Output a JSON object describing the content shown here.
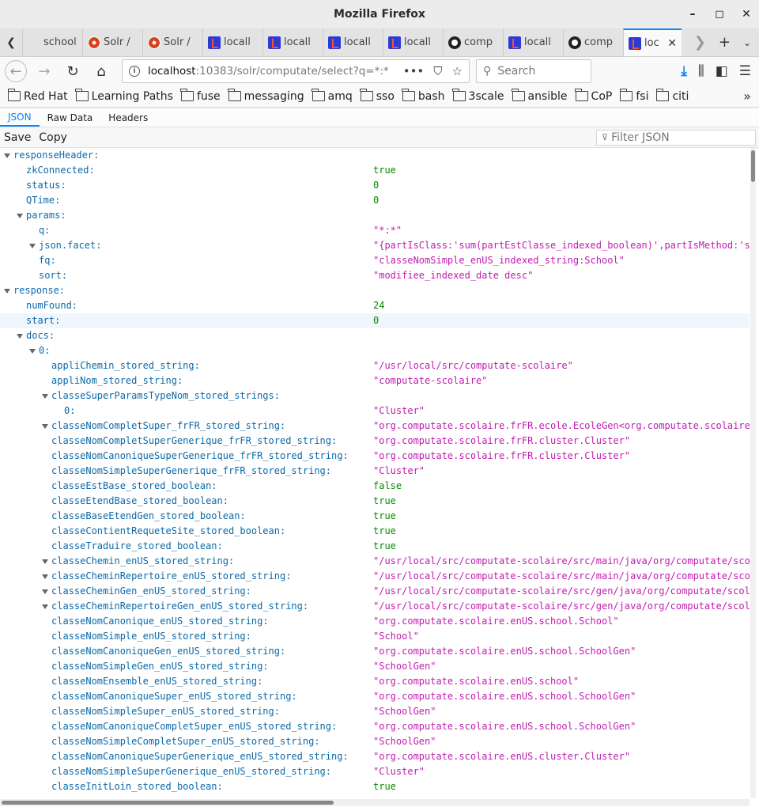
{
  "window": {
    "title": "Mozilla Firefox"
  },
  "tabs": [
    {
      "label": "school.c",
      "icon": "blank-icon"
    },
    {
      "label": "Solr /",
      "icon": "solr-icon"
    },
    {
      "label": "Solr /",
      "icon": "solr-icon"
    },
    {
      "label": "locall",
      "icon": "sonar-icon"
    },
    {
      "label": "locall",
      "icon": "sonar-icon"
    },
    {
      "label": "locall",
      "icon": "sonar-icon"
    },
    {
      "label": "locall",
      "icon": "sonar-icon"
    },
    {
      "label": "comp",
      "icon": "github-icon"
    },
    {
      "label": "locall",
      "icon": "sonar-icon"
    },
    {
      "label": "comp",
      "icon": "github-icon"
    },
    {
      "label": "loc",
      "icon": "sonar-icon",
      "active": true
    }
  ],
  "nav": {
    "url_host": "localhost",
    "url_rest": ":10383/solr/computate/select?q=*:*",
    "search_placeholder": "Search"
  },
  "bookmarks": [
    "Red Hat",
    "Learning Paths",
    "fuse",
    "messaging",
    "amq",
    "sso",
    "bash",
    "3scale",
    "ansible",
    "CoP",
    "fsi",
    "citi"
  ],
  "viewer": {
    "tabs": [
      "JSON",
      "Raw Data",
      "Headers"
    ],
    "save_label": "Save",
    "copy_label": "Copy",
    "filter_placeholder": "Filter JSON"
  },
  "rows": [
    {
      "d": 0,
      "k": "responseHeader:",
      "t": 1
    },
    {
      "d": 1,
      "k": "zkConnected:",
      "v": "true",
      "vt": "bool"
    },
    {
      "d": 1,
      "k": "status:",
      "v": "0",
      "vt": "num"
    },
    {
      "d": 1,
      "k": "QTime:",
      "v": "0",
      "vt": "num"
    },
    {
      "d": 1,
      "k": "params:",
      "t": 1
    },
    {
      "d": 2,
      "k": "q:",
      "v": "\"*:*\"",
      "vt": "str"
    },
    {
      "d": 2,
      "k": "json.facet:",
      "t": 1,
      "v": "\"{partIsClass:'sum(partEstClasse_indexed_boolean)',partIsMethod:'sum",
      "vt": "str"
    },
    {
      "d": 2,
      "k": "fq:",
      "v": "\"classeNomSimple_enUS_indexed_string:School\"",
      "vt": "str"
    },
    {
      "d": 2,
      "k": "sort:",
      "v": "\"modifiee_indexed_date desc\"",
      "vt": "str"
    },
    {
      "d": 0,
      "k": "response:",
      "t": 1
    },
    {
      "d": 1,
      "k": "numFound:",
      "v": "24",
      "vt": "num"
    },
    {
      "d": 1,
      "k": "start:",
      "v": "0",
      "vt": "num",
      "hl": 1
    },
    {
      "d": 1,
      "k": "docs:",
      "t": 1
    },
    {
      "d": 2,
      "k": "0:",
      "t": 1
    },
    {
      "d": 3,
      "k": "appliChemin_stored_string:",
      "v": "\"/usr/local/src/computate-scolaire\"",
      "vt": "str"
    },
    {
      "d": 3,
      "k": "appliNom_stored_string:",
      "v": "\"computate-scolaire\"",
      "vt": "str"
    },
    {
      "d": 3,
      "k": "classeSuperParamsTypeNom_stored_strings:",
      "t": 1
    },
    {
      "d": 4,
      "k": "0:",
      "v": "\"Cluster\"",
      "vt": "str"
    },
    {
      "d": 3,
      "k": "classeNomCompletSuper_frFR_stored_string:",
      "t": 1,
      "v": "\"org.computate.scolaire.frFR.ecole.EcoleGen<org.computate.scolaire.f",
      "vt": "str"
    },
    {
      "d": 3,
      "k": "classeNomCompletSuperGenerique_frFR_stored_string:",
      "v": "\"org.computate.scolaire.frFR.cluster.Cluster\"",
      "vt": "str"
    },
    {
      "d": 3,
      "k": "classeNomCanoniqueSuperGenerique_frFR_stored_string:",
      "v": "\"org.computate.scolaire.frFR.cluster.Cluster\"",
      "vt": "str"
    },
    {
      "d": 3,
      "k": "classeNomSimpleSuperGenerique_frFR_stored_string:",
      "v": "\"Cluster\"",
      "vt": "str"
    },
    {
      "d": 3,
      "k": "classeEstBase_stored_boolean:",
      "v": "false",
      "vt": "bool"
    },
    {
      "d": 3,
      "k": "classeEtendBase_stored_boolean:",
      "v": "true",
      "vt": "bool"
    },
    {
      "d": 3,
      "k": "classeBaseEtendGen_stored_boolean:",
      "v": "true",
      "vt": "bool"
    },
    {
      "d": 3,
      "k": "classeContientRequeteSite_stored_boolean:",
      "v": "true",
      "vt": "bool"
    },
    {
      "d": 3,
      "k": "classeTraduire_stored_boolean:",
      "v": "true",
      "vt": "bool"
    },
    {
      "d": 3,
      "k": "classeChemin_enUS_stored_string:",
      "t": 1,
      "v": "\"/usr/local/src/computate-scolaire/src/main/java/org/computate/scola",
      "vt": "str"
    },
    {
      "d": 3,
      "k": "classeCheminRepertoire_enUS_stored_string:",
      "t": 1,
      "v": "\"/usr/local/src/computate-scolaire/src/main/java/org/computate/scola",
      "vt": "str"
    },
    {
      "d": 3,
      "k": "classeCheminGen_enUS_stored_string:",
      "t": 1,
      "v": "\"/usr/local/src/computate-scolaire/src/gen/java/org/computate/scolai",
      "vt": "str"
    },
    {
      "d": 3,
      "k": "classeCheminRepertoireGen_enUS_stored_string:",
      "t": 1,
      "v": "\"/usr/local/src/computate-scolaire/src/gen/java/org/computate/scolai",
      "vt": "str"
    },
    {
      "d": 3,
      "k": "classeNomCanonique_enUS_stored_string:",
      "v": "\"org.computate.scolaire.enUS.school.School\"",
      "vt": "str"
    },
    {
      "d": 3,
      "k": "classeNomSimple_enUS_stored_string:",
      "v": "\"School\"",
      "vt": "str"
    },
    {
      "d": 3,
      "k": "classeNomCanoniqueGen_enUS_stored_string:",
      "v": "\"org.computate.scolaire.enUS.school.SchoolGen\"",
      "vt": "str"
    },
    {
      "d": 3,
      "k": "classeNomSimpleGen_enUS_stored_string:",
      "v": "\"SchoolGen\"",
      "vt": "str"
    },
    {
      "d": 3,
      "k": "classeNomEnsemble_enUS_stored_string:",
      "v": "\"org.computate.scolaire.enUS.school\"",
      "vt": "str"
    },
    {
      "d": 3,
      "k": "classeNomCanoniqueSuper_enUS_stored_string:",
      "v": "\"org.computate.scolaire.enUS.school.SchoolGen\"",
      "vt": "str"
    },
    {
      "d": 3,
      "k": "classeNomSimpleSuper_enUS_stored_string:",
      "v": "\"SchoolGen\"",
      "vt": "str"
    },
    {
      "d": 3,
      "k": "classeNomCanoniqueCompletSuper_enUS_stored_string:",
      "v": "\"org.computate.scolaire.enUS.school.SchoolGen\"",
      "vt": "str"
    },
    {
      "d": 3,
      "k": "classeNomSimpleCompletSuper_enUS_stored_string:",
      "v": "\"SchoolGen\"",
      "vt": "str"
    },
    {
      "d": 3,
      "k": "classeNomCanoniqueSuperGenerique_enUS_stored_string:",
      "v": "\"org.computate.scolaire.enUS.cluster.Cluster\"",
      "vt": "str"
    },
    {
      "d": 3,
      "k": "classeNomSimpleSuperGenerique_enUS_stored_string:",
      "v": "\"Cluster\"",
      "vt": "str"
    },
    {
      "d": 3,
      "k": "classeInitLoin_stored_boolean:",
      "v": "true",
      "vt": "bool"
    }
  ]
}
